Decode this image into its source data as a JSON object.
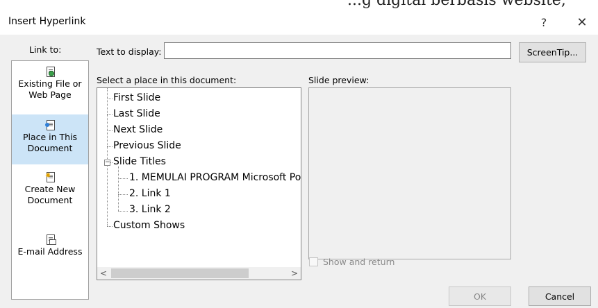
{
  "top_partial_text": "...g digital berbasis website,",
  "dialog": {
    "title": "Insert Hyperlink",
    "help_label": "?",
    "close_label": "✕"
  },
  "link_to": {
    "label": "Link to:",
    "items": [
      {
        "line1": "Existing File or",
        "line2": "Web Page",
        "icon": "existing-file-icon",
        "selected": false
      },
      {
        "line1": "Place in This",
        "line2": "Document",
        "icon": "place-in-document-icon",
        "selected": true
      },
      {
        "line1": "Create New",
        "line2": "Document",
        "icon": "create-new-document-icon",
        "selected": false
      },
      {
        "line1": "E-mail Address",
        "line2": "",
        "icon": "email-address-icon",
        "selected": false
      }
    ]
  },
  "text_to_display": {
    "label": "Text to display:",
    "value": ""
  },
  "screentip_label": "ScreenTip...",
  "select_place": {
    "label": "Select a place in this document:",
    "items": [
      "First Slide",
      "Last Slide",
      "Next Slide",
      "Previous Slide",
      "Slide Titles",
      "Custom Shows"
    ],
    "slide_titles": [
      "1. MEMULAI PROGRAM Microsoft Po",
      "2. Link 1",
      "3. Link 2"
    ],
    "expander": "−"
  },
  "slide_preview_label": "Slide preview:",
  "show_and_return_label": "Show and return",
  "buttons": {
    "ok": "OK",
    "cancel": "Cancel"
  },
  "colors": {
    "selected_bg": "#cce4f7",
    "dialog_bg": "#f0f0f0"
  }
}
